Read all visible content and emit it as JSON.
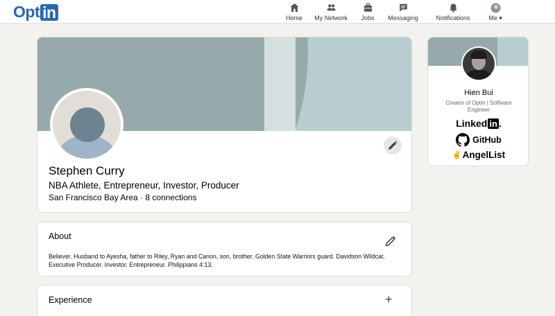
{
  "logo": {
    "part1": "Opt",
    "part2": "in"
  },
  "nav": {
    "home": "Home",
    "network": "My Network",
    "jobs": "Jobs",
    "messaging": "Messaging",
    "notifications": "Notifications",
    "me": "Me ▾"
  },
  "profile": {
    "name": "Stephen Curry",
    "headline": "NBA Athlete, Entrepreneur, Investor, Producer",
    "location": "San Francisco Bay Area · 8 connections"
  },
  "about": {
    "title": "About",
    "text": "Believer. Husband to Ayesha, father to Riley, Ryan and Canon, son, brother. Golden State Warriors guard. Davidson Wildcat. Executive Producer. Investor. Entrepreneur. Philippians 4:13."
  },
  "experience": {
    "title": "Experience",
    "add": "+"
  },
  "side": {
    "name": "Hien Bui",
    "title": "Creator of OptIn | Software Engineer",
    "linkedin_a": "Linked",
    "linkedin_b": "in",
    "linkedin_c": ".",
    "github": "GitHub",
    "angel": "AngelList",
    "angel_mark": "✌"
  },
  "colors": {
    "brand": "#2867b2",
    "banner": "#b8cdd0",
    "banner_dark": "#97aaab"
  }
}
